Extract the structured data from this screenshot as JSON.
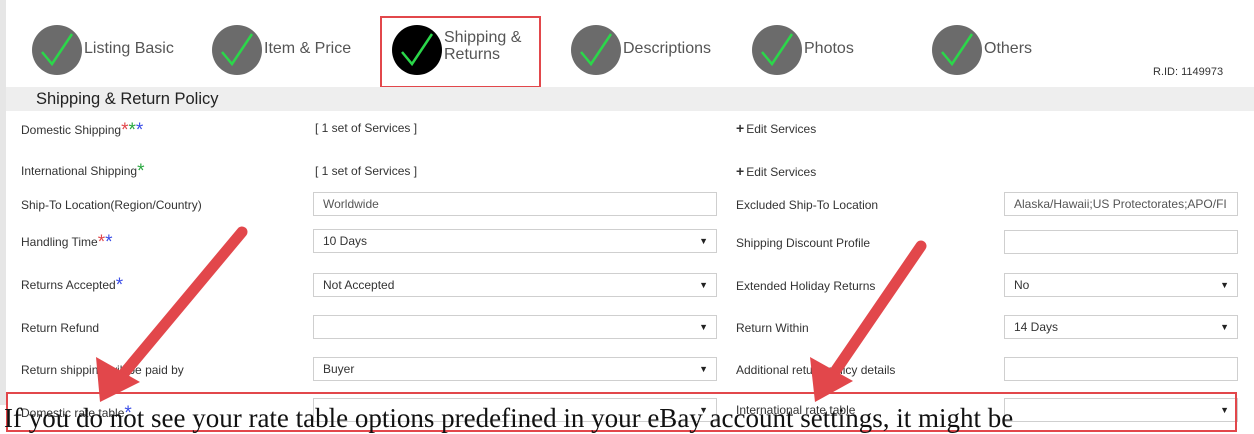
{
  "steps": [
    {
      "label": "Listing Basic"
    },
    {
      "label": "Item & Price"
    },
    {
      "label": "Shipping & Returns"
    },
    {
      "label": "Descriptions"
    },
    {
      "label": "Photos"
    },
    {
      "label": "Others"
    }
  ],
  "rid": "R.ID: 1149973",
  "section_title": "Shipping & Return Policy",
  "rows": {
    "domestic_shipping": {
      "label": "Domestic Shipping",
      "value": "[ 1 set of Services ]",
      "action": "Edit Services"
    },
    "international_shipping": {
      "label": "International Shipping",
      "value": "[ 1 set of Services ]",
      "action": "Edit Services"
    },
    "ship_to": {
      "label": "Ship-To Location(Region/Country)",
      "value": "Worldwide"
    },
    "excluded": {
      "label": "Excluded Ship-To Location",
      "value": "Alaska/Hawaii;US Protectorates;APO/FI"
    },
    "handling": {
      "label": "Handling Time",
      "value": "10 Days"
    },
    "discount": {
      "label": "Shipping Discount Profile",
      "value": ""
    },
    "returns_accepted": {
      "label": "Returns Accepted",
      "value": "Not Accepted"
    },
    "holiday": {
      "label": "Extended Holiday Returns",
      "value": "No"
    },
    "refund": {
      "label": "Return Refund",
      "value": ""
    },
    "return_within": {
      "label": "Return Within",
      "value": "14 Days"
    },
    "paid_by": {
      "label": "Return shipping will be paid by",
      "value": "Buyer"
    },
    "additional": {
      "label": "Additional return policy details",
      "value": ""
    },
    "domestic_rate": {
      "label": "Domestic rate table",
      "value": ""
    },
    "intl_rate": {
      "label": "International rate table",
      "value": ""
    }
  },
  "caption": "If you do not see your rate table options predefined in your eBay account settings, it might be",
  "colors": {
    "accent_red": "#e2474b",
    "check_green": "#2bd74a",
    "star_red": "#e2474b",
    "star_green": "#2aa841",
    "star_blue": "#3c4ee6"
  }
}
